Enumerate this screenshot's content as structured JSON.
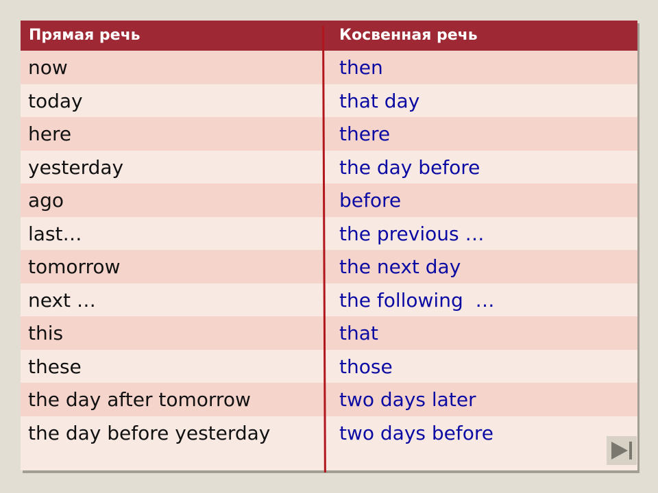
{
  "table": {
    "headers": {
      "direct": "Прямая речь",
      "indirect": "Косвенная речь"
    },
    "rows": [
      {
        "direct": "now",
        "indirect": "then"
      },
      {
        "direct": "today",
        "indirect": "that day"
      },
      {
        "direct": "here",
        "indirect": "there"
      },
      {
        "direct": "yesterday",
        "indirect": "the day before"
      },
      {
        "direct": "ago",
        "indirect": "before"
      },
      {
        "direct": "last…",
        "indirect": "the previous …"
      },
      {
        "direct": "tomorrow",
        "indirect": "the next day"
      },
      {
        "direct": "next …",
        "indirect": "the following  …"
      },
      {
        "direct": "this",
        "indirect": "that"
      },
      {
        "direct": "these",
        "indirect": "those"
      },
      {
        "direct": "the day after tomorrow",
        "indirect": "two days later"
      },
      {
        "direct": "the day before yesterday",
        "indirect": "two days before"
      }
    ]
  },
  "controls": {
    "next_icon": "skip-next-icon"
  },
  "colors": {
    "header_bg": "#9e2934",
    "row_odd": "#f5d4cc",
    "row_even": "#f9e9e3",
    "direct_text": "#111111",
    "indirect_text": "#0b0ba3",
    "divider": "#b0161c",
    "page_bg": "#e3ded4"
  }
}
